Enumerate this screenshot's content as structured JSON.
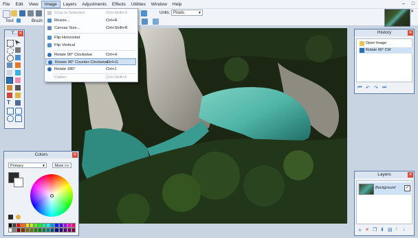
{
  "menubar": {
    "items": [
      "File",
      "Edit",
      "View",
      "Image",
      "Layers",
      "Adjustments",
      "Effects",
      "Utilities",
      "Window",
      "Help"
    ],
    "active": "Image"
  },
  "toolbar": {
    "tool_label": "Tool:",
    "brush_label": "Brush",
    "units_label": "Units:",
    "units_value": "Pixels"
  },
  "image_menu": {
    "items": [
      {
        "label": "Crop to Selection",
        "shortcut": "Ctrl+Shift+X",
        "disabled": true
      },
      {
        "label": "Resize...",
        "shortcut": "Ctrl+R",
        "disabled": false
      },
      {
        "label": "Canvas Size...",
        "shortcut": "Ctrl+Shift+R",
        "disabled": false
      },
      {
        "label": "Flip Horizontal",
        "shortcut": "",
        "disabled": false
      },
      {
        "label": "Flip Vertical",
        "shortcut": "",
        "disabled": false
      },
      {
        "label": "Rotate 90° Clockwise",
        "shortcut": "Ctrl+H",
        "disabled": false
      },
      {
        "label": "Rotate 90° Counter-Clockwise",
        "shortcut": "Ctrl+G",
        "disabled": false,
        "highlighted": true
      },
      {
        "label": "Rotate 180°",
        "shortcut": "Ctrl+J",
        "disabled": false
      },
      {
        "label": "Flatten",
        "shortcut": "Ctrl+Shift+F",
        "disabled": true
      }
    ]
  },
  "tools_panel": {
    "title": "T..."
  },
  "history": {
    "title": "History",
    "items": [
      "Open Image",
      "Rotate 90° CW"
    ]
  },
  "colors": {
    "title": "Colors",
    "mode": "Primary",
    "more_label": "More >>"
  },
  "layers": {
    "title": "Layers",
    "items": [
      {
        "name": "Background",
        "visible": true
      }
    ]
  },
  "palette": [
    "#000000",
    "#404040",
    "#ff0000",
    "#ff6a00",
    "#ffd800",
    "#b6ff00",
    "#4cff00",
    "#00ff21",
    "#00ff90",
    "#00ffff",
    "#0094ff",
    "#0026ff",
    "#4800ff",
    "#b200ff",
    "#ff00dc",
    "#ff006e",
    "#ffffff",
    "#808080",
    "#7f0000",
    "#7f3300",
    "#7f6a00",
    "#5b7f00",
    "#267f00",
    "#007f0e",
    "#007f46",
    "#007f7f",
    "#004a7f",
    "#00137f",
    "#21007f",
    "#57007f",
    "#7f006e",
    "#7f0037"
  ],
  "accent_color": "#2d6db5"
}
